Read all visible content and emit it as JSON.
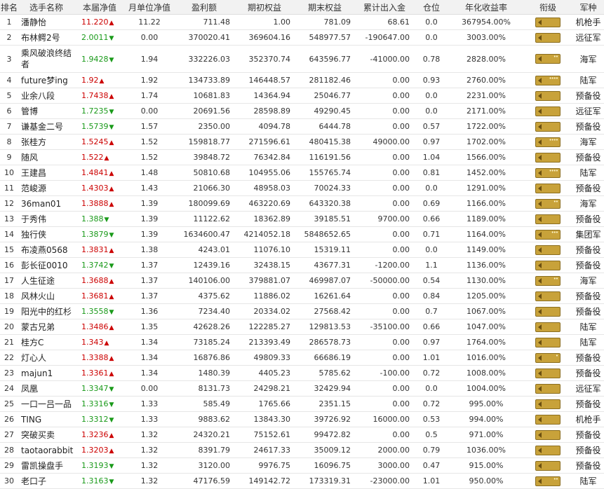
{
  "headers": [
    "排名",
    "选手名称",
    "本届净值",
    "月单位净值",
    "盈利额",
    "期初权益",
    "期末权益",
    "累计出入金",
    "仓位",
    "年化收益率",
    "衔级",
    "军种"
  ],
  "rows": [
    {
      "rank": "1",
      "name": "潘静怡",
      "nav": "11.220",
      "dir": "up",
      "monthly": "11.22",
      "profit": "711.48",
      "start": "1.00",
      "end": "781.09",
      "flow": "68.61",
      "pos": "0.0",
      "annual": "367954.00%",
      "stars": "",
      "army": "机枪手"
    },
    {
      "rank": "2",
      "name": "布林鳄2号",
      "nav": "2.0011",
      "dir": "down",
      "monthly": "0.00",
      "profit": "370020.41",
      "start": "369604.16",
      "end": "548977.57",
      "flow": "-190647.00",
      "pos": "0.0",
      "annual": "3003.00%",
      "stars": "",
      "army": "远征军"
    },
    {
      "rank": "3",
      "name": "乘风破浪终结者",
      "nav": "1.9428",
      "dir": "down",
      "monthly": "1.94",
      "profit": "332226.03",
      "start": "352370.74",
      "end": "643596.77",
      "flow": "-41000.00",
      "pos": "0.78",
      "annual": "2828.00%",
      "stars": "••",
      "army": "海军"
    },
    {
      "rank": "4",
      "name": "future梦ing",
      "nav": "1.92",
      "dir": "up",
      "monthly": "1.92",
      "profit": "134733.89",
      "start": "146448.57",
      "end": "281182.46",
      "flow": "0.00",
      "pos": "0.93",
      "annual": "2760.00%",
      "stars": "••••",
      "army": "陆军"
    },
    {
      "rank": "5",
      "name": "业余八段",
      "nav": "1.7438",
      "dir": "up",
      "monthly": "1.74",
      "profit": "10681.83",
      "start": "14364.94",
      "end": "25046.77",
      "flow": "0.00",
      "pos": "0.0",
      "annual": "2231.00%",
      "stars": "",
      "army": "预备役"
    },
    {
      "rank": "6",
      "name": "管博",
      "nav": "1.7235",
      "dir": "down",
      "monthly": "0.00",
      "profit": "20691.56",
      "start": "28598.89",
      "end": "49290.45",
      "flow": "0.00",
      "pos": "0.0",
      "annual": "2171.00%",
      "stars": "",
      "army": "远征军"
    },
    {
      "rank": "7",
      "name": "谦基金二号",
      "nav": "1.5739",
      "dir": "down",
      "monthly": "1.57",
      "profit": "2350.00",
      "start": "4094.78",
      "end": "6444.78",
      "flow": "0.00",
      "pos": "0.57",
      "annual": "1722.00%",
      "stars": "",
      "army": "预备役"
    },
    {
      "rank": "8",
      "name": "张桂方",
      "nav": "1.5245",
      "dir": "up",
      "monthly": "1.52",
      "profit": "159818.77",
      "start": "271596.61",
      "end": "480415.38",
      "flow": "49000.00",
      "pos": "0.97",
      "annual": "1702.00%",
      "stars": "••••",
      "army": "海军"
    },
    {
      "rank": "9",
      "name": "随风",
      "nav": "1.522",
      "dir": "up",
      "monthly": "1.52",
      "profit": "39848.72",
      "start": "76342.84",
      "end": "116191.56",
      "flow": "0.00",
      "pos": "1.04",
      "annual": "1566.00%",
      "stars": "",
      "army": "预备役"
    },
    {
      "rank": "10",
      "name": "王建昌",
      "nav": "1.4841",
      "dir": "up",
      "monthly": "1.48",
      "profit": "50810.68",
      "start": "104955.06",
      "end": "155765.74",
      "flow": "0.00",
      "pos": "0.81",
      "annual": "1452.00%",
      "stars": "••••",
      "army": "陆军"
    },
    {
      "rank": "11",
      "name": "范峻源",
      "nav": "1.4303",
      "dir": "up",
      "monthly": "1.43",
      "profit": "21066.30",
      "start": "48958.03",
      "end": "70024.33",
      "flow": "0.00",
      "pos": "0.0",
      "annual": "1291.00%",
      "stars": "",
      "army": "预备役"
    },
    {
      "rank": "12",
      "name": "36man01",
      "nav": "1.3888",
      "dir": "up",
      "monthly": "1.39",
      "profit": "180099.69",
      "start": "463220.69",
      "end": "643320.38",
      "flow": "0.00",
      "pos": "0.69",
      "annual": "1166.00%",
      "stars": "••",
      "army": "海军"
    },
    {
      "rank": "13",
      "name": "于秀伟",
      "nav": "1.388",
      "dir": "down",
      "monthly": "1.39",
      "profit": "11122.62",
      "start": "18362.89",
      "end": "39185.51",
      "flow": "9700.00",
      "pos": "0.66",
      "annual": "1189.00%",
      "stars": "",
      "army": "预备役"
    },
    {
      "rank": "14",
      "name": "独行侠",
      "nav": "1.3879",
      "dir": "down",
      "monthly": "1.39",
      "profit": "1634600.47",
      "start": "4214052.18",
      "end": "5848652.65",
      "flow": "0.00",
      "pos": "0.71",
      "annual": "1164.00%",
      "stars": "•••",
      "army": "集团军"
    },
    {
      "rank": "15",
      "name": "布凌燕0568",
      "nav": "1.3831",
      "dir": "up",
      "monthly": "1.38",
      "profit": "4243.01",
      "start": "11076.10",
      "end": "15319.11",
      "flow": "0.00",
      "pos": "0.0",
      "annual": "1149.00%",
      "stars": "",
      "army": "预备役"
    },
    {
      "rank": "16",
      "name": "彭长征0010",
      "nav": "1.3742",
      "dir": "down",
      "monthly": "1.37",
      "profit": "12439.16",
      "start": "32438.15",
      "end": "43677.31",
      "flow": "-1200.00",
      "pos": "1.1",
      "annual": "1136.00%",
      "stars": "",
      "army": "预备役"
    },
    {
      "rank": "17",
      "name": "人生征途",
      "nav": "1.3688",
      "dir": "up",
      "monthly": "1.37",
      "profit": "140106.00",
      "start": "379881.07",
      "end": "469987.07",
      "flow": "-50000.00",
      "pos": "0.54",
      "annual": "1130.00%",
      "stars": "••",
      "army": "海军"
    },
    {
      "rank": "18",
      "name": "风林火山",
      "nav": "1.3681",
      "dir": "up",
      "monthly": "1.37",
      "profit": "4375.62",
      "start": "11886.02",
      "end": "16261.64",
      "flow": "0.00",
      "pos": "0.84",
      "annual": "1205.00%",
      "stars": "",
      "army": "预备役"
    },
    {
      "rank": "19",
      "name": "阳光中的红杉",
      "nav": "1.3558",
      "dir": "down",
      "monthly": "1.36",
      "profit": "7234.40",
      "start": "20334.02",
      "end": "27568.42",
      "flow": "0.00",
      "pos": "0.7",
      "annual": "1067.00%",
      "stars": "",
      "army": "预备役"
    },
    {
      "rank": "20",
      "name": "蒙古兄弟",
      "nav": "1.3486",
      "dir": "up",
      "monthly": "1.35",
      "profit": "42628.26",
      "start": "122285.27",
      "end": "129813.53",
      "flow": "-35100.00",
      "pos": "0.66",
      "annual": "1047.00%",
      "stars": "",
      "army": "陆军"
    },
    {
      "rank": "21",
      "name": "桂方C",
      "nav": "1.343",
      "dir": "up",
      "monthly": "1.34",
      "profit": "73185.24",
      "start": "213393.49",
      "end": "286578.73",
      "flow": "0.00",
      "pos": "0.97",
      "annual": "1764.00%",
      "stars": "",
      "army": "陆军"
    },
    {
      "rank": "22",
      "name": "灯心人",
      "nav": "1.3388",
      "dir": "up",
      "monthly": "1.34",
      "profit": "16876.86",
      "start": "49809.33",
      "end": "66686.19",
      "flow": "0.00",
      "pos": "1.01",
      "annual": "1016.00%",
      "stars": "•",
      "army": "预备役"
    },
    {
      "rank": "23",
      "name": "majun1",
      "nav": "1.3361",
      "dir": "up",
      "monthly": "1.34",
      "profit": "1480.39",
      "start": "4405.23",
      "end": "5785.62",
      "flow": "-100.00",
      "pos": "0.72",
      "annual": "1008.00%",
      "stars": "",
      "army": "预备役"
    },
    {
      "rank": "24",
      "name": "凤凰",
      "nav": "1.3347",
      "dir": "down",
      "monthly": "0.00",
      "profit": "8131.73",
      "start": "24298.21",
      "end": "32429.94",
      "flow": "0.00",
      "pos": "0.0",
      "annual": "1004.00%",
      "stars": "",
      "army": "远征军"
    },
    {
      "rank": "25",
      "name": "一口一吕一品",
      "nav": "1.3316",
      "dir": "down",
      "monthly": "1.33",
      "profit": "585.49",
      "start": "1765.66",
      "end": "2351.15",
      "flow": "0.00",
      "pos": "0.72",
      "annual": "995.00%",
      "stars": "",
      "army": "预备役"
    },
    {
      "rank": "26",
      "name": "TING",
      "nav": "1.3312",
      "dir": "down",
      "monthly": "1.33",
      "profit": "9883.62",
      "start": "13843.30",
      "end": "39726.92",
      "flow": "16000.00",
      "pos": "0.53",
      "annual": "994.00%",
      "stars": "",
      "army": "机枪手"
    },
    {
      "rank": "27",
      "name": "突破买卖",
      "nav": "1.3236",
      "dir": "up",
      "monthly": "1.32",
      "profit": "24320.21",
      "start": "75152.61",
      "end": "99472.82",
      "flow": "0.00",
      "pos": "0.5",
      "annual": "971.00%",
      "stars": "",
      "army": "预备役"
    },
    {
      "rank": "28",
      "name": "taotaorabbit",
      "nav": "1.3203",
      "dir": "up",
      "monthly": "1.32",
      "profit": "8391.79",
      "start": "24617.33",
      "end": "35009.12",
      "flow": "2000.00",
      "pos": "0.79",
      "annual": "1036.00%",
      "stars": "",
      "army": "预备役"
    },
    {
      "rank": "29",
      "name": "雷凯操盘手",
      "nav": "1.3193",
      "dir": "down",
      "monthly": "1.32",
      "profit": "3120.00",
      "start": "9976.75",
      "end": "16096.75",
      "flow": "3000.00",
      "pos": "0.47",
      "annual": "915.00%",
      "stars": "",
      "army": "预备役"
    },
    {
      "rank": "30",
      "name": "老口子",
      "nav": "1.3163",
      "dir": "down",
      "monthly": "1.32",
      "profit": "47176.59",
      "start": "149142.72",
      "end": "173319.31",
      "flow": "-23000.00",
      "pos": "1.01",
      "annual": "950.00%",
      "stars": "••",
      "army": "陆军"
    }
  ],
  "icons": {
    "up": "red-up-arrow-icon",
    "down": "green-down-arrow-icon",
    "badge": "rank-insignia-icon"
  },
  "colors": {
    "up": "#cc0000",
    "down": "#1a9a1a",
    "badge": "#c8a23a"
  }
}
